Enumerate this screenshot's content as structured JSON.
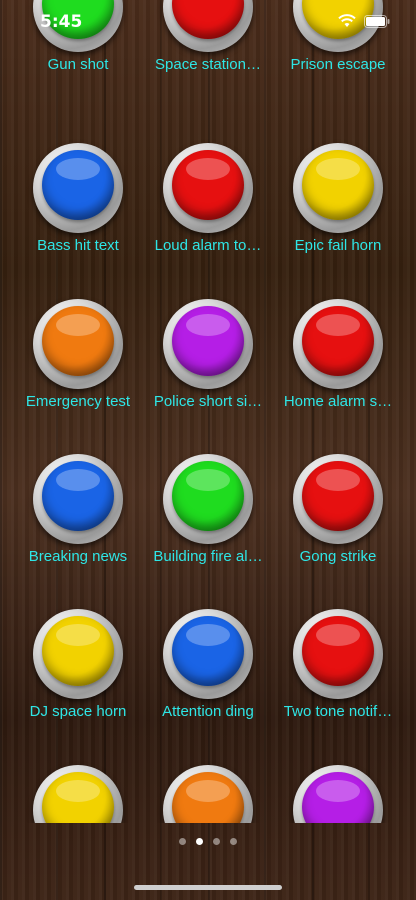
{
  "status_bar": {
    "time": "5:45",
    "wifi_icon": "wifi-icon",
    "battery_icon": "battery-icon"
  },
  "sounds": [
    {
      "label": "Gun shot",
      "color": "#1fdc1f"
    },
    {
      "label": "Space station…",
      "color": "#e61010"
    },
    {
      "label": "Prison escape",
      "color": "#f2d200"
    },
    {
      "label": "Bass hit text",
      "color": "#1a64e6"
    },
    {
      "label": "Loud alarm to…",
      "color": "#e61010"
    },
    {
      "label": "Epic fail horn",
      "color": "#f2d200"
    },
    {
      "label": "Emergency test",
      "color": "#f07a10"
    },
    {
      "label": "Police short si…",
      "color": "#b51ee6"
    },
    {
      "label": "Home alarm s…",
      "color": "#e61010"
    },
    {
      "label": "Breaking news",
      "color": "#1a64e6"
    },
    {
      "label": "Building fire al…",
      "color": "#1fdc1f"
    },
    {
      "label": "Gong strike",
      "color": "#e61010"
    },
    {
      "label": "DJ space horn",
      "color": "#f2d200"
    },
    {
      "label": "Attention ding",
      "color": "#1a64e6"
    },
    {
      "label": "Two tone notif…",
      "color": "#e61010"
    },
    {
      "label": "",
      "color": "#f2d200"
    },
    {
      "label": "",
      "color": "#f07a10"
    },
    {
      "label": "",
      "color": "#b51ee6"
    }
  ],
  "pager": {
    "page_count": 4,
    "current_page": 2
  }
}
